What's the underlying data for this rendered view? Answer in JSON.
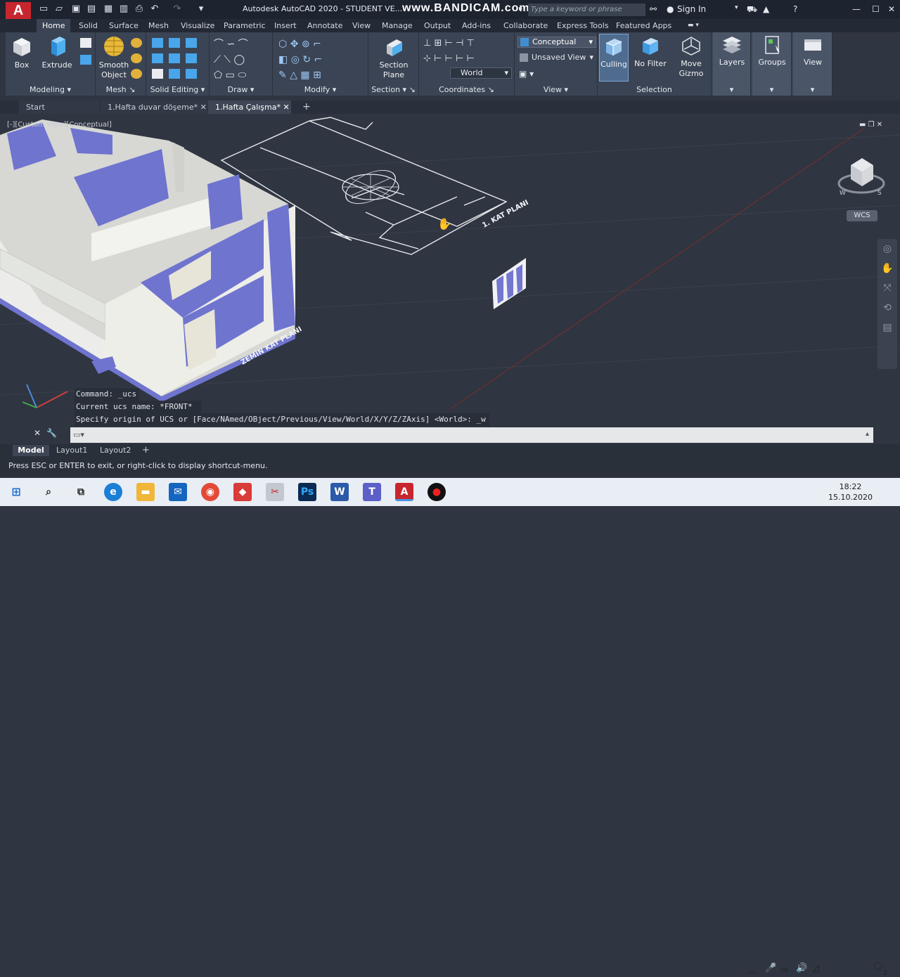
{
  "titlebar": {
    "title": "Autodesk AutoCAD 2020 - STUDENT VE...",
    "watermark": "www.BANDICAM.com",
    "search_placeholder": "Type a keyword or phrase",
    "sign_in": "Sign In"
  },
  "ribbon_tabs": [
    "Home",
    "Solid",
    "Surface",
    "Mesh",
    "Visualize",
    "Parametric",
    "Insert",
    "Annotate",
    "View",
    "Manage",
    "Output",
    "Add-ins",
    "Collaborate",
    "Express Tools",
    "Featured Apps"
  ],
  "ribbon": {
    "modeling": {
      "label": "Modeling",
      "box": "Box",
      "extrude": "Extrude"
    },
    "mesh": {
      "label": "Mesh",
      "smooth": "Smooth",
      "object": "Object"
    },
    "solid_editing": {
      "label": "Solid Editing"
    },
    "draw": {
      "label": "Draw"
    },
    "modify": {
      "label": "Modify"
    },
    "section": {
      "label": "Section",
      "section": "Section",
      "plane": "Plane"
    },
    "coordinates": {
      "label": "Coordinates",
      "world": "World"
    },
    "view": {
      "label": "View",
      "visual_style": "Conceptual",
      "named_view": "Unsaved View"
    },
    "selection": {
      "label": "Selection",
      "culling": "Culling",
      "nofilter": "No Filter",
      "move": "Move",
      "gizmo": "Gizmo"
    },
    "layers": "Layers",
    "groups": "Groups",
    "viewbtn": "View"
  },
  "file_tabs": [
    "Start",
    "1.Hafta duvar döşeme*",
    "1.Hafta Çalışma*"
  ],
  "viewport": {
    "label": "[-][Custom View][Conceptual]",
    "wcs": "WCS",
    "plan1": "1. KAT PLANI",
    "plan0": "ZEMİN KAT PLANI"
  },
  "command": {
    "lines": [
      "Command: _ucs",
      "Current ucs name:  *FRONT*",
      "Specify origin of UCS or [Face/NAmed/OBject/Previous/View/World/X/Y/Z/ZAxis] <World>: _w"
    ]
  },
  "layout_tabs": [
    "Model",
    "Layout1",
    "Layout2"
  ],
  "status": "Press ESC or ENTER to exit, or right-click to display shortcut-menu.",
  "clock": {
    "time": "18:22",
    "date": "15.10.2020"
  },
  "notif_count": "2"
}
